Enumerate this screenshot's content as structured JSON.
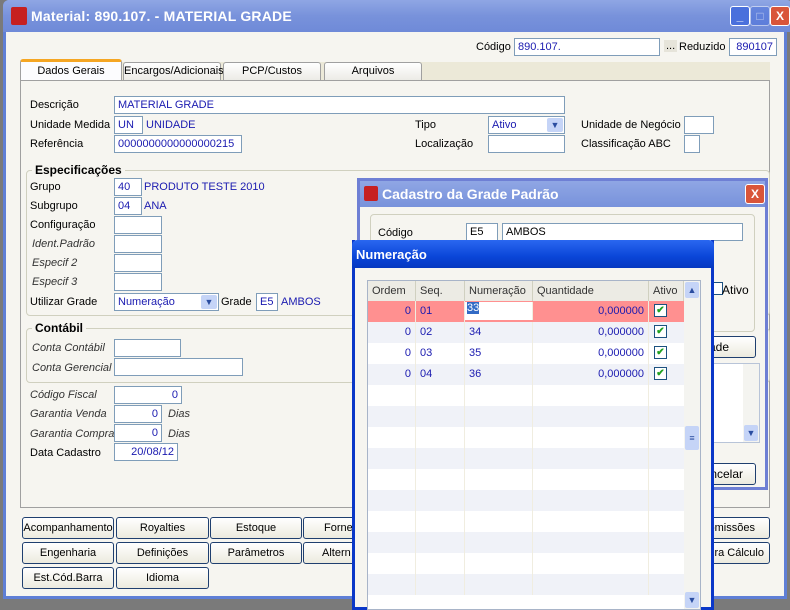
{
  "window": {
    "title": "Material: 890.107. - MATERIAL GRADE",
    "minimize": "_",
    "maximize": "□",
    "close": "X"
  },
  "header": {
    "codigo_label": "Código",
    "codigo_value": "890.107.",
    "lookup_label": "...",
    "reduzido_label": "Reduzido",
    "reduzido_value": "890107"
  },
  "tabs": [
    {
      "label": "Dados Gerais",
      "active": true
    },
    {
      "label": "Encargos/Adicionais"
    },
    {
      "label": "PCP/Custos"
    },
    {
      "label": "Arquivos"
    }
  ],
  "general": {
    "descricao_label": "Descrição",
    "descricao": "MATERIAL GRADE",
    "unidade_label": "Unidade Medida",
    "unidade_code": "UN",
    "unidade_name": "UNIDADE",
    "referencia_label": "Referência",
    "referencia": "0000000000000000215",
    "tipo_label": "Tipo",
    "tipo": "Ativo",
    "localizacao_label": "Localização",
    "localizacao": "",
    "unidade_negocio_label": "Unidade de Negócio",
    "unidade_negocio": "",
    "classificacao_label": "Classificação ABC",
    "classificacao": ""
  },
  "especificacoes": {
    "title": "Especificações",
    "grupo_label": "Grupo",
    "grupo_code": "40",
    "grupo_name": "PRODUTO TESTE 2010",
    "subgrupo_label": "Subgrupo",
    "subgrupo_code": "04",
    "subgrupo_name": "ANA",
    "configuracao_label": "Configuração",
    "ident_label": "Ident.Padrão",
    "especif2_label": "Especif 2",
    "especif3_label": "Especif 3",
    "utilizar_grade_label": "Utilizar Grade",
    "utilizar_grade": "Numeração",
    "grade_label": "Grade",
    "grade_code": "E5",
    "grade_name": "AMBOS"
  },
  "contabil": {
    "title": "Contábil",
    "conta_contabil_label": "Conta Contábil",
    "conta_gerencial_label": "Conta Gerencial"
  },
  "other": {
    "codigo_fiscal_label": "Código Fiscal",
    "codigo_fiscal": "0",
    "garantia_venda_label": "Garantia Venda",
    "garantia_venda": "0",
    "garantia_compra_label": "Garantia Compra",
    "garantia_compra": "0",
    "dias_label": "Dias",
    "data_cadastro_label": "Data Cadastro",
    "data_cadastro": "20/08/12"
  },
  "buttons": {
    "row1": [
      "Acompanhamento",
      "Royalties",
      "Estoque",
      "Forne",
      "omissões"
    ],
    "row2": [
      "Engenharia",
      "Definições",
      "Parâmetros",
      "Altern",
      "ra Cálculo"
    ],
    "row3": [
      "Est.Cód.Barra",
      "Idioma"
    ]
  },
  "cadastro_dialog": {
    "title": "Cadastro da Grade Padrão",
    "codigo_label": "Código",
    "codigo": "E5",
    "descricao": "AMBOS",
    "ativo_label": "Ativo",
    "grade_button": "ade",
    "cancelar_button": "ncelar",
    "close": "X"
  },
  "numeracao_dialog": {
    "title": "Numeração",
    "columns": [
      "Ordem",
      "Seq.",
      "Numeração",
      "Quantidade",
      "Ativo"
    ],
    "rows": [
      {
        "ordem": "0",
        "seq": "01",
        "numeracao": "33",
        "quantidade": "0,000000",
        "ativo": true,
        "selected": true
      },
      {
        "ordem": "0",
        "seq": "02",
        "numeracao": "34",
        "quantidade": "0,000000",
        "ativo": true
      },
      {
        "ordem": "0",
        "seq": "03",
        "numeracao": "35",
        "quantidade": "0,000000",
        "ativo": true
      },
      {
        "ordem": "0",
        "seq": "04",
        "numeracao": "36",
        "quantidade": "0,000000",
        "ativo": true
      }
    ]
  },
  "colors": {
    "title_bar": "#7892db",
    "selected_row": "#ff9090",
    "active_tab_accent": "#f5a623",
    "numeracao_title": "#0a45d8"
  }
}
